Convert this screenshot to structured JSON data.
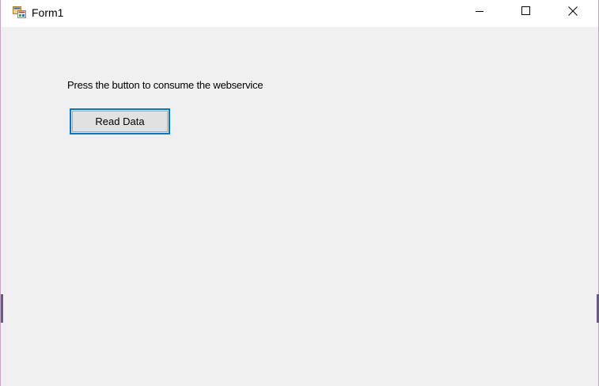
{
  "window": {
    "title": "Form1",
    "controls": {
      "minimize_icon": "minimize-icon",
      "maximize_icon": "maximize-icon",
      "close_icon": "close-icon"
    }
  },
  "form": {
    "prompt_text": "Press the button to consume the webservice",
    "read_button_label": "Read Data"
  },
  "colors": {
    "focus_border": "#0078d7",
    "client_background": "#f0f0f0",
    "button_face": "#e1e1e1"
  }
}
